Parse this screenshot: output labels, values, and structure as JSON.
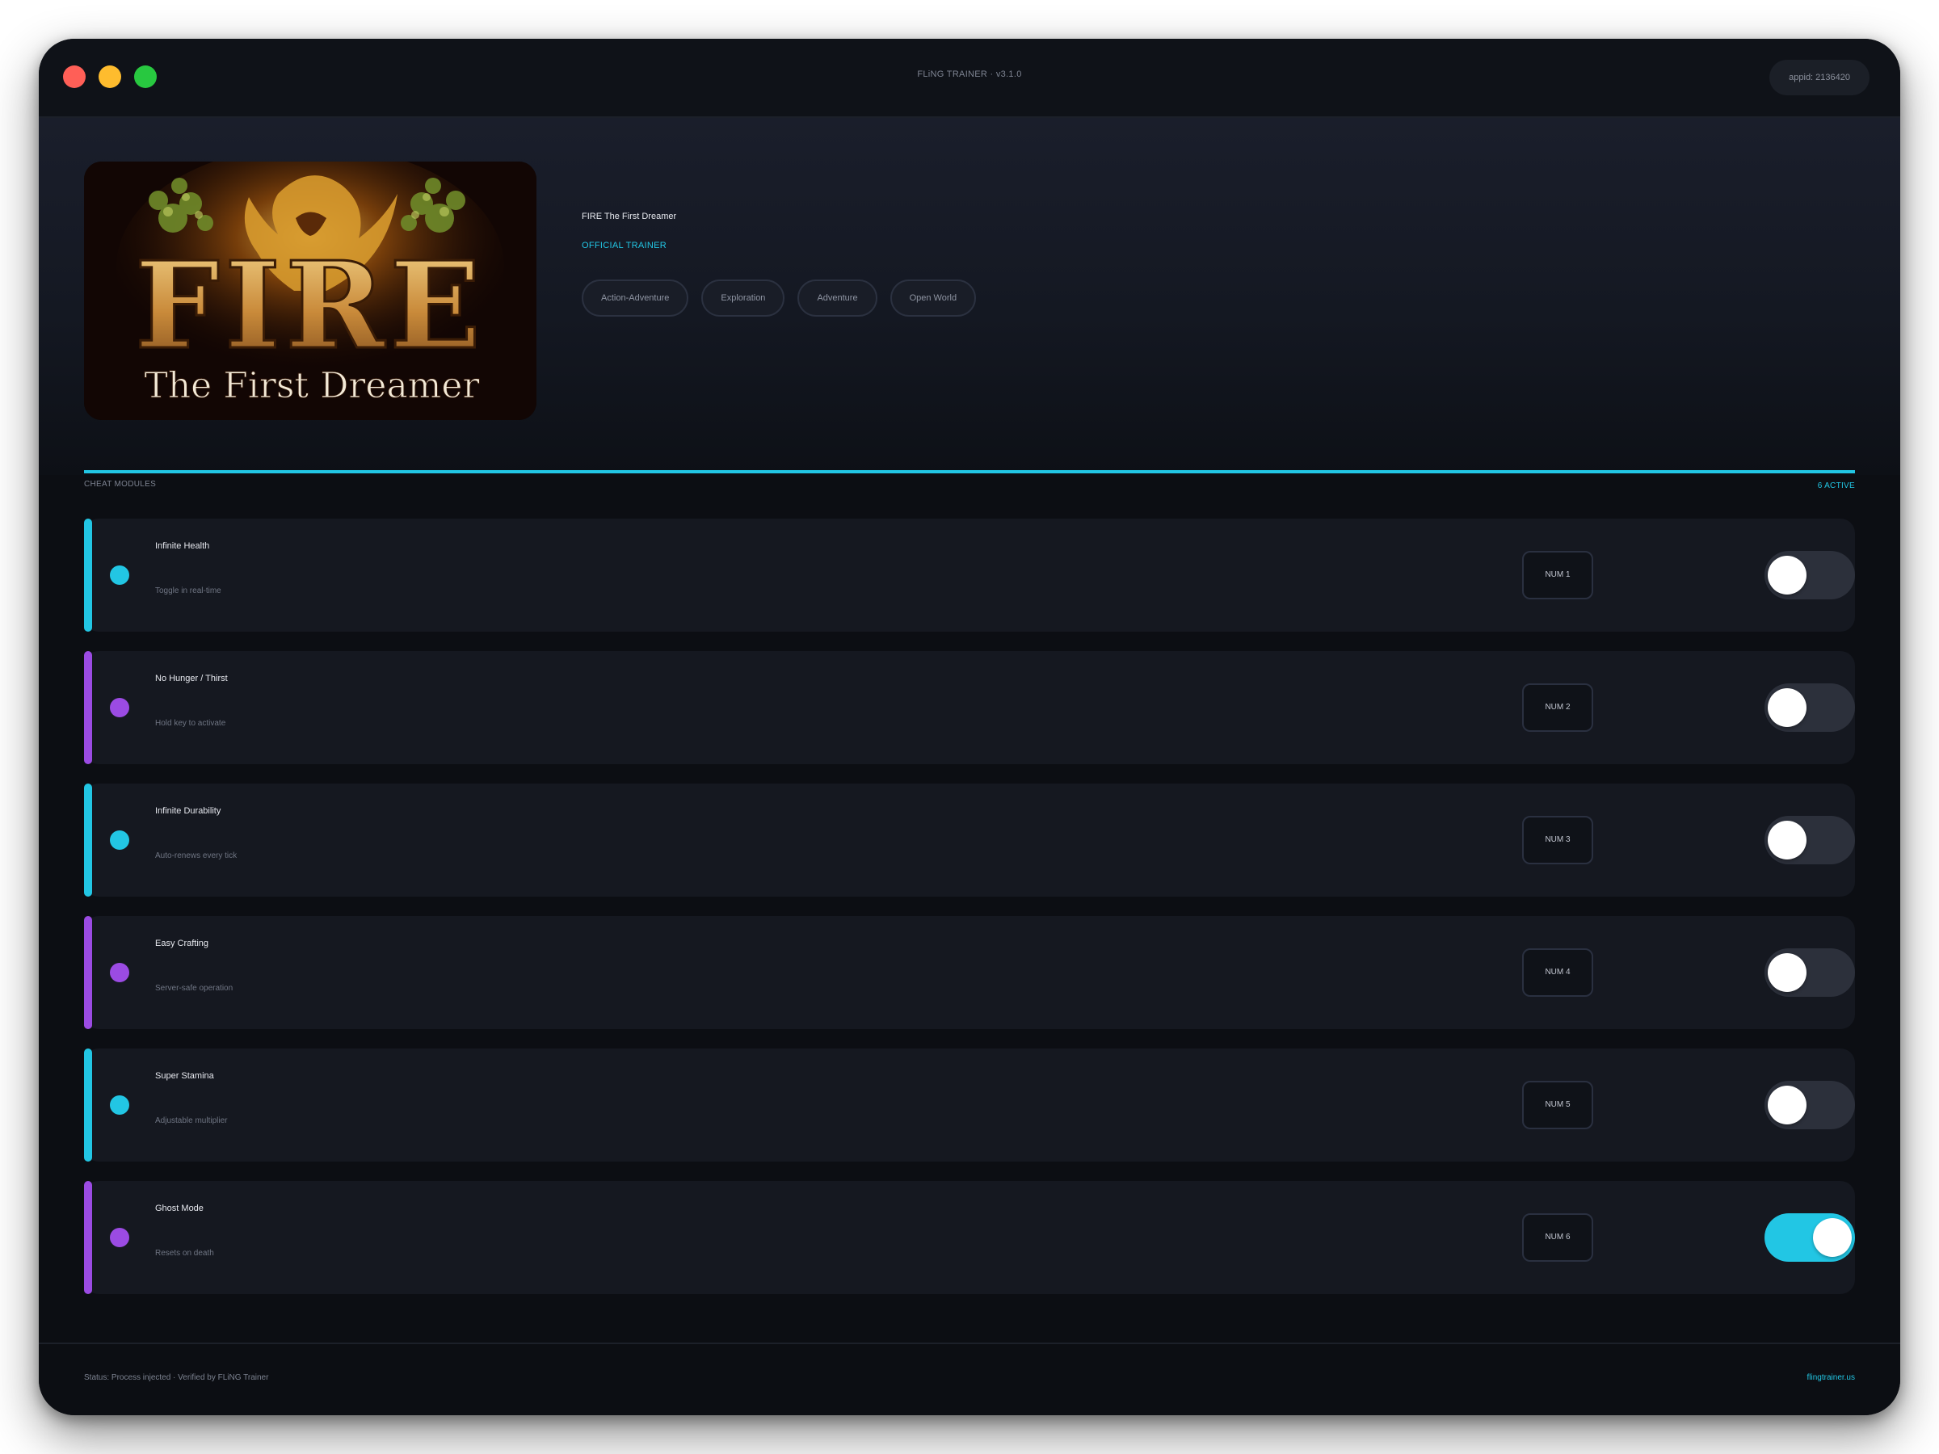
{
  "window": {
    "title": "FLiNG TRAINER · v3.1.0",
    "appid": "appid: 2136420",
    "traffic_lights": [
      "#ff5f57",
      "#febc2e",
      "#28c840"
    ]
  },
  "game": {
    "title": "FIRE The First Dreamer",
    "badge": "OFFICIAL TRAINER",
    "tags": [
      "Action-Adventure",
      "Exploration",
      "Adventure",
      "Open World"
    ],
    "cover": {
      "logo_text": "FIRE",
      "subtitle_text": "The First Dreamer"
    }
  },
  "section": {
    "label": "CHEAT MODULES",
    "count": "6 ACTIVE"
  },
  "colors": {
    "cyan": "#22c6e4",
    "purple": "#9b4be3"
  },
  "cheats": [
    {
      "name": "Infinite Health",
      "desc": "Toggle in real-time",
      "key": "NUM 1",
      "color": "#22c6e4",
      "enabled": false
    },
    {
      "name": "No Hunger / Thirst",
      "desc": "Hold key to activate",
      "key": "NUM 2",
      "color": "#9b4be3",
      "enabled": false
    },
    {
      "name": "Infinite Durability",
      "desc": "Auto-renews every tick",
      "key": "NUM 3",
      "color": "#22c6e4",
      "enabled": false
    },
    {
      "name": "Easy Crafting",
      "desc": "Server-safe operation",
      "key": "NUM 4",
      "color": "#9b4be3",
      "enabled": false
    },
    {
      "name": "Super Stamina",
      "desc": "Adjustable multiplier",
      "key": "NUM 5",
      "color": "#22c6e4",
      "enabled": false
    },
    {
      "name": "Ghost Mode",
      "desc": "Resets on death",
      "key": "NUM 6",
      "color": "#9b4be3",
      "enabled": true
    }
  ],
  "footer": {
    "status": "Status: Process injected · Verified by FLiNG Trainer",
    "link": "flingtrainer.us"
  }
}
